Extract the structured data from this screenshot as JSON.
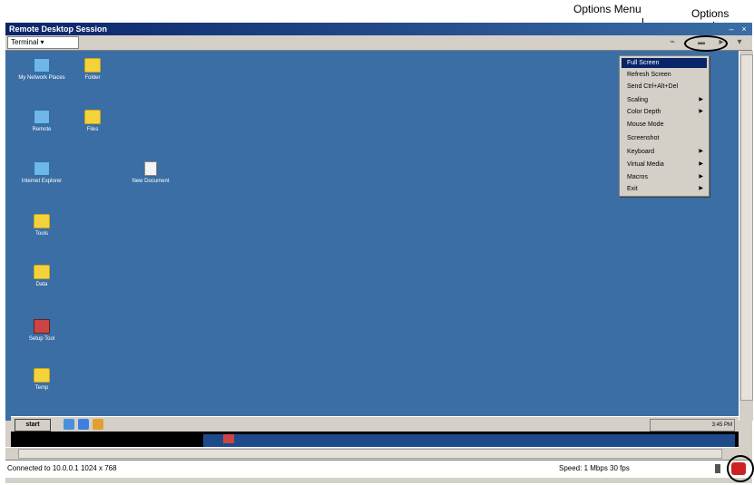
{
  "annotations": {
    "options_menu_label": "Options Menu",
    "options_label": "Options"
  },
  "window": {
    "title": "Remote Desktop Session",
    "toolbar_field": "Terminal ▾"
  },
  "desktop_icons": [
    {
      "label": "My Network Places",
      "kind": "netplaces"
    },
    {
      "label": "Folder",
      "kind": "folder"
    },
    {
      "label": "Remote",
      "kind": "netplaces"
    },
    {
      "label": "Files",
      "kind": "folder"
    },
    {
      "label": "Internet Explorer",
      "kind": "netplaces"
    },
    {
      "label": "New Document",
      "kind": "doc"
    },
    {
      "label": "Tools",
      "kind": "folder"
    },
    {
      "label": "Data",
      "kind": "folder"
    },
    {
      "label": "Setup Tool",
      "kind": "app"
    },
    {
      "label": "Temp",
      "kind": "folder"
    }
  ],
  "options_menu": {
    "items": [
      {
        "label": "Full Screen",
        "submenu": false,
        "selected": true
      },
      {
        "label": "Refresh Screen",
        "submenu": false,
        "selected": false
      },
      {
        "label": "Send Ctrl+Alt+Del",
        "submenu": false,
        "selected": false
      },
      {
        "label": "Scaling",
        "submenu": true,
        "selected": false
      },
      {
        "label": "Color Depth",
        "submenu": true,
        "selected": false
      },
      {
        "label": "Mouse Mode",
        "submenu": false,
        "selected": false
      },
      {
        "label": "Screenshot",
        "submenu": false,
        "selected": false
      },
      {
        "label": "Keyboard",
        "submenu": true,
        "selected": false
      },
      {
        "label": "Virtual Media",
        "submenu": true,
        "selected": false
      },
      {
        "label": "Macros",
        "submenu": true,
        "selected": false
      },
      {
        "label": "Exit",
        "submenu": true,
        "selected": false
      }
    ]
  },
  "taskbar": {
    "start_label": "start",
    "tray_text": "3:45 PM"
  },
  "statusbar": {
    "left_text": "Connected to 10.0.0.1  1024 x 768",
    "right_text": "Speed: 1 Mbps  30 fps"
  },
  "colors": {
    "desktop": "#3a6ea5",
    "titlebar": "#0a246a",
    "menu": "#d4d0c8"
  }
}
